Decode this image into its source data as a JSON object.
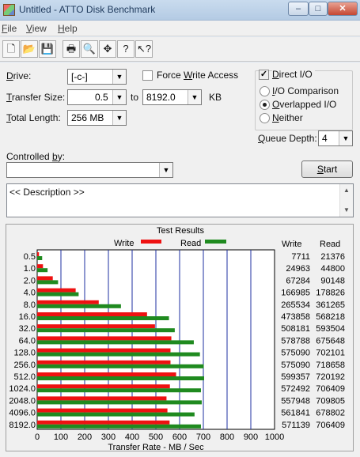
{
  "window": {
    "title": "Untitled - ATTO Disk Benchmark",
    "buttons": {
      "minimize": "–",
      "maximize": "□",
      "close": "✕"
    }
  },
  "menu": [
    "File",
    "View",
    "Help"
  ],
  "toolbar": [
    {
      "name": "new-icon",
      "glyph": "🗋"
    },
    {
      "name": "open-icon",
      "glyph": "📂"
    },
    {
      "name": "save-icon",
      "glyph": "💾"
    },
    {
      "name": "print-icon",
      "glyph": "🖶"
    },
    {
      "name": "print-preview-icon",
      "glyph": "🔍"
    },
    {
      "name": "move-icon",
      "glyph": "✥"
    },
    {
      "name": "help-icon",
      "glyph": "?"
    },
    {
      "name": "context-help-icon",
      "glyph": "↖?"
    }
  ],
  "settings": {
    "drive_label": "Drive:",
    "drive_value": "[-c-]",
    "force_write_label": "Force Write Access",
    "direct_io_label": "Direct I/O",
    "transfer_size_label": "Transfer Size:",
    "transfer_from": "0.5",
    "transfer_to_label": "to",
    "transfer_to": "8192.0",
    "kb_label": "KB",
    "total_length_label": "Total Length:",
    "total_length_value": "256 MB",
    "io_comparison_label": "I/O Comparison",
    "overlapped_io_label": "Overlapped I/O",
    "neither_label": "Neither",
    "queue_depth_label": "Queue Depth:",
    "queue_depth_value": "4",
    "controlled_by_label": "Controlled by:",
    "controlled_by_value": "",
    "start_label": "Start",
    "description": "<< Description >>"
  },
  "results": {
    "title": "Test Results",
    "write_legend": "Write",
    "read_legend": "Read",
    "write_col": "Write",
    "read_col": "Read",
    "write_color": "#ee1111",
    "read_color": "#1f8a1f"
  },
  "chart_data": {
    "type": "bar",
    "orientation": "horizontal",
    "xlabel": "Transfer Rate - MB / Sec",
    "xlim": [
      0,
      1000
    ],
    "xticks": [
      "0",
      "100",
      "200",
      "300",
      "400",
      "500",
      "600",
      "700",
      "800",
      "900",
      "1000"
    ],
    "categories": [
      "0.5",
      "1.0",
      "2.0",
      "4.0",
      "8.0",
      "16.0",
      "32.0",
      "64.0",
      "128.0",
      "256.0",
      "512.0",
      "1024.0",
      "2048.0",
      "4096.0",
      "8192.0"
    ],
    "series": [
      {
        "name": "Write",
        "values": [
          7.5,
          24.4,
          65.7,
          162.1,
          259.3,
          462.8,
          496.3,
          565.2,
          561.6,
          561.6,
          585.3,
          559.1,
          544.8,
          548.7,
          557.8
        ]
      },
      {
        "name": "Read",
        "values": [
          20.9,
          43.8,
          88.0,
          174.6,
          352.9,
          555.2,
          579.6,
          659.8,
          685.6,
          701.8,
          703.3,
          689.9,
          693.2,
          662.9,
          689.9
        ]
      }
    ],
    "table": [
      {
        "write": "7711",
        "read": "21376"
      },
      {
        "write": "24963",
        "read": "44800"
      },
      {
        "write": "67284",
        "read": "90148"
      },
      {
        "write": "166985",
        "read": "178826"
      },
      {
        "write": "265534",
        "read": "361265"
      },
      {
        "write": "473858",
        "read": "568218"
      },
      {
        "write": "508181",
        "read": "593504"
      },
      {
        "write": "578788",
        "read": "675648"
      },
      {
        "write": "575090",
        "read": "702101"
      },
      {
        "write": "575090",
        "read": "718658"
      },
      {
        "write": "599357",
        "read": "720192"
      },
      {
        "write": "572492",
        "read": "706409"
      },
      {
        "write": "557948",
        "read": "709805"
      },
      {
        "write": "561841",
        "read": "678802"
      },
      {
        "write": "571139",
        "read": "706409"
      }
    ]
  }
}
